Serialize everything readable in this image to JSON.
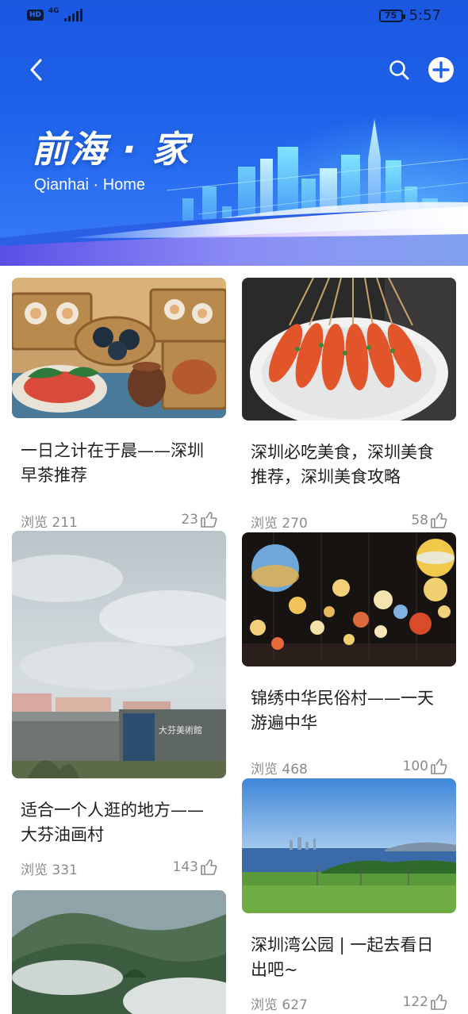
{
  "status_bar": {
    "hd": "HD",
    "network": "4G",
    "battery": "75",
    "time": "5:57"
  },
  "header": {
    "back_icon": "chevron-left-icon",
    "search_icon": "search-icon",
    "add_icon": "plus-circle-icon",
    "title": "前海 · 家",
    "subtitle": "Qianhai · Home"
  },
  "cards": [
    {
      "title": "一日之计在于晨——深圳早茶推荐",
      "views": "浏览 211",
      "likes": "23",
      "image": "dim-sum-photo"
    },
    {
      "title": "深圳必吃美食，深圳美食推荐，深圳美食攻略",
      "views": "浏览 270",
      "likes": "58",
      "image": "grilled-shrimp-photo"
    },
    {
      "title": "适合一个人逛的地方——大芬油画村",
      "views": "浏览 331",
      "likes": "143",
      "image": "art-museum-sky-photo"
    },
    {
      "title": "锦绣中华民俗村——一天游遍中华",
      "views": "浏览 468",
      "likes": "100",
      "image": "lanterns-photo"
    },
    {
      "title": "深圳湾公园 | 一起去看日出吧~",
      "views": "浏览 627",
      "likes": "122",
      "image": "bay-park-photo"
    },
    {
      "title": "",
      "views": "",
      "likes": "",
      "image": "misty-mountain-photo"
    }
  ],
  "colors": {
    "banner": "#1e63ea",
    "text": "#1f1f1f",
    "meta": "#8a8a8a"
  }
}
